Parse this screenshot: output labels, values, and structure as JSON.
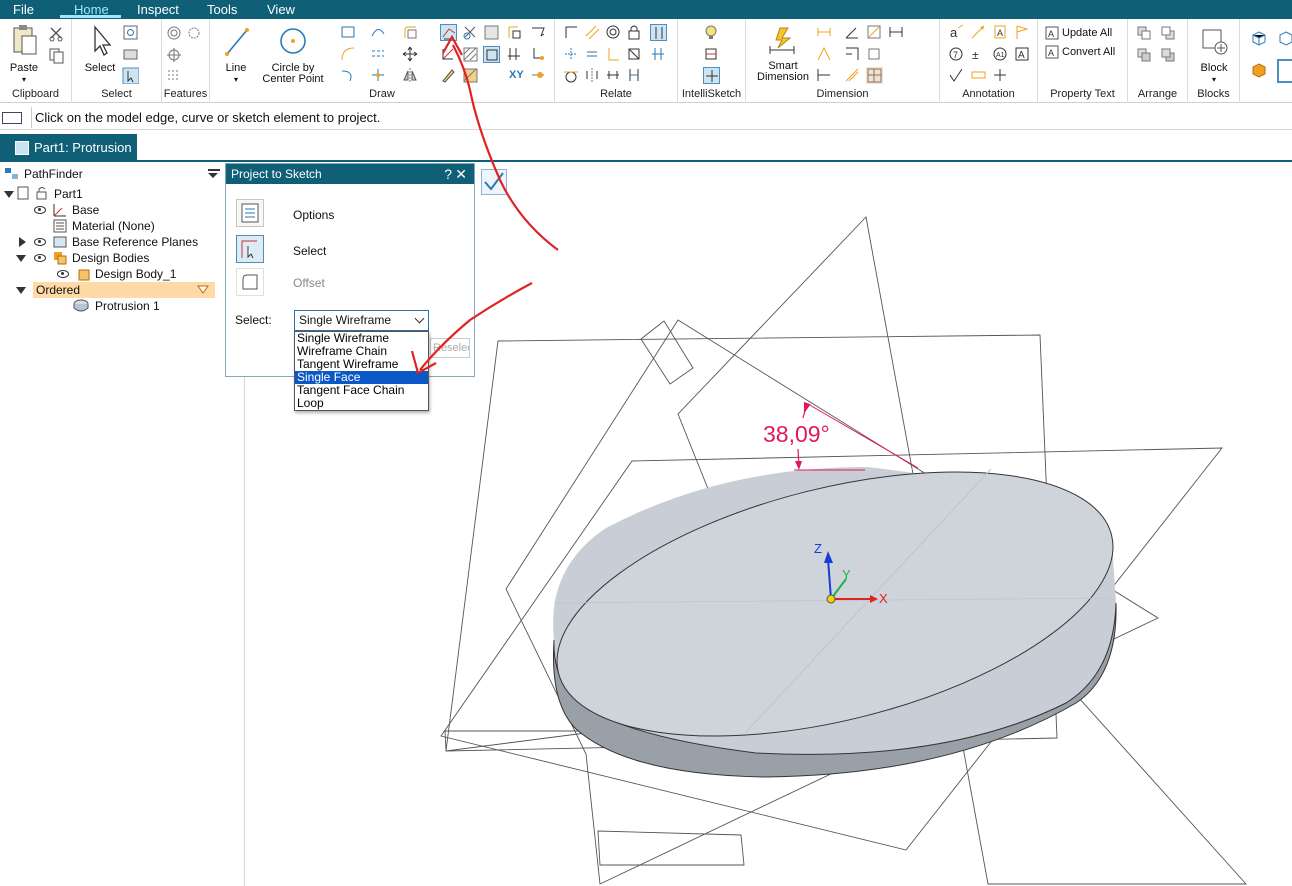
{
  "menu": {
    "file": "File",
    "home": "Home",
    "inspect": "Inspect",
    "tools": "Tools",
    "view": "View"
  },
  "ribbon": {
    "clipboard": {
      "label": "Clipboard",
      "paste": "Paste"
    },
    "select": {
      "label": "Select",
      "select": "Select"
    },
    "features": {
      "label": "Features"
    },
    "draw": {
      "label": "Draw",
      "line": "Line",
      "circle_line1": "Circle by",
      "circle_line2": "Center Point"
    },
    "relate": {
      "label": "Relate"
    },
    "intellisketch": {
      "label": "IntelliSketch"
    },
    "dimension": {
      "label": "Dimension",
      "smart_line1": "Smart",
      "smart_line2": "Dimension"
    },
    "annotation": {
      "label": "Annotation"
    },
    "property_text": {
      "label": "Property Text",
      "update_all": "Update All",
      "convert_all": "Convert All"
    },
    "arrange": {
      "label": "Arrange"
    },
    "blocks": {
      "label": "Blocks",
      "block": "Block"
    },
    "xy_glyph": "XY"
  },
  "prompt": "Click on the model edge, curve or sketch element to project.",
  "doc_tab": "Part1: Protrusion",
  "pathfinder": {
    "title": "PathFinder",
    "part": "Part1",
    "base": "Base",
    "material": "Material (None)",
    "base_ref_planes": "Base Reference Planes",
    "design_bodies": "Design Bodies",
    "design_body_1": "Design Body_1",
    "ordered": "Ordered",
    "protrusion_1": "Protrusion 1"
  },
  "dialog": {
    "title": "Project to Sketch",
    "help": "?",
    "close": "✕",
    "options": "Options",
    "select": "Select",
    "offset": "Offset",
    "select_label": "Select:",
    "select_value": "Single Wireframe",
    "reselect": "Reselect",
    "dropdown_options": [
      "Single Wireframe",
      "Wireframe Chain",
      "Tangent Wireframe",
      "Single Face",
      "Tangent Face Chain",
      "Loop"
    ],
    "highlighted_option": "Single Face"
  },
  "viewport": {
    "angle_dimension": "38,09°",
    "axis_x": "X",
    "axis_y": "Y",
    "axis_z": "Z"
  },
  "colors": {
    "menubar": "#0f5f77",
    "dimension": "#e0195b",
    "annotation_arrow": "#e02222",
    "highlight": "#0a58c6",
    "body": "#c9ced6"
  }
}
